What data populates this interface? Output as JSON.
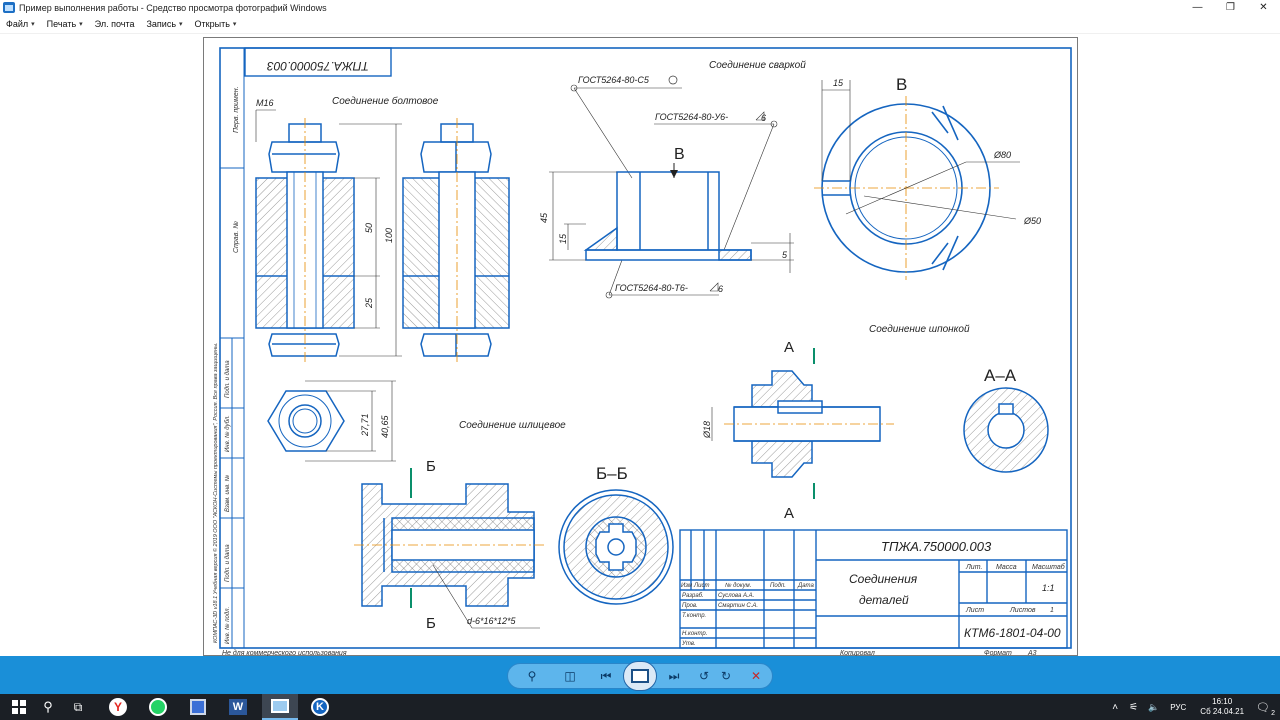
{
  "window": {
    "title": "Пример выполнения работы - Средство просмотра фотографий Windows",
    "minimize_glyph": "—",
    "maximize_glyph": "❐",
    "close_glyph": "✕"
  },
  "menu": {
    "items": [
      {
        "label": "Файл",
        "has_caret": true
      },
      {
        "label": "Печать",
        "has_caret": true
      },
      {
        "label": "Эл. почта",
        "has_caret": false
      },
      {
        "label": "Запись",
        "has_caret": true
      },
      {
        "label": "Открыть",
        "has_caret": true
      }
    ],
    "caret_glyph": "▾"
  },
  "drawing": {
    "designation_top": "ТПЖА.750000.003",
    "titles": {
      "bolted": "Соединение болтовое",
      "welded": "Соединение сваркой",
      "keyed": "Соединение шпонкой",
      "splined": "Соединение шлицевое"
    },
    "bolt": {
      "thread": "M16",
      "dim_50": "50",
      "dim_100": "100",
      "dim_25": "25",
      "dim_2771": "27,71",
      "dim_4065": "40,65"
    },
    "weld": {
      "callout_1": "ГОСТ5264-80-С5",
      "callout_2": "ГОСТ5264-80-У6-",
      "callout_2_leg": "6",
      "callout_3": "ГОСТ5264-80-Т6-",
      "callout_3_leg": "6",
      "view_letter": "В",
      "dim_45": "45",
      "dim_15": "15",
      "dim_5": "5"
    },
    "view_b": {
      "letter": "В",
      "dim_15": "15",
      "dim_80": "Ø80",
      "dim_50": "Ø50"
    },
    "key": {
      "section_letter": "А",
      "section_title": "А–А",
      "dim_18": "Ø18"
    },
    "spline": {
      "section_letter": "Б",
      "section_title": "Б–Б",
      "spec": "d-6*16*12*5"
    },
    "side_stamp": "КОМПАС-3D v18.1 Учебная версия © 2019 ООО \"АСКОН-Системы проектирования\", Россия. Все права защищены.",
    "side_labels": [
      "Перв. примен.",
      "Справ. №",
      "Подп. и дата",
      "Инв. № дубл.",
      "Взам. инв. №",
      "Подп. и дата",
      "Инв. № подл."
    ],
    "title_block": {
      "designation": "ТПЖА.750000.003",
      "name_line1": "Соединения",
      "name_line2": "деталей",
      "col_headers": [
        "Изм",
        "Лист",
        "№ докум.",
        "Подп.",
        "Дата"
      ],
      "rows": [
        {
          "role": "Разраб.",
          "name": "Суслова А.А."
        },
        {
          "role": "Пров.",
          "name": "Смартин С.А."
        },
        {
          "role": "Т.контр.",
          "name": ""
        },
        {
          "role": "Н.контр.",
          "name": ""
        },
        {
          "role": "Утв.",
          "name": ""
        }
      ],
      "lit": "Лит.",
      "mass": "Масса",
      "scale": "Масштаб",
      "scale_value": "1:1",
      "sheet": "Лист",
      "sheets": "Листов",
      "sheets_value": "1",
      "org": "КТМ6-1801-04-00"
    },
    "footer_left": "Не для коммерческого использования",
    "footer_copy": "Копировал",
    "footer_format": "Формат",
    "footer_format_value": "А3"
  },
  "photo_toolbar": {
    "zoom_glyph": "⚲",
    "fit_glyph": "◫",
    "prev_glyph": "⏮",
    "next_glyph": "⏭",
    "rotate_ccw_glyph": "↺",
    "rotate_cw_glyph": "↻",
    "delete_glyph": "✕"
  },
  "taskbar": {
    "lang": "РУС",
    "time": "16:10",
    "date": "Сб 24.04.21",
    "notification_count": "2",
    "word_letter": "W",
    "yandex_letter": "Y",
    "kompas_letter": "K",
    "search_glyph": "⚲",
    "taskview_glyph": "⧉",
    "tray_up_glyph": "˄",
    "network_glyph": "⚟",
    "volume_glyph": "🔈",
    "notification_glyph": "🗨"
  },
  "colors": {
    "drawing_blue": "#1565c0",
    "axis_orange": "#e68a00",
    "photo_bar": "#1a8fd8",
    "taskbar": "#1b1f25"
  }
}
